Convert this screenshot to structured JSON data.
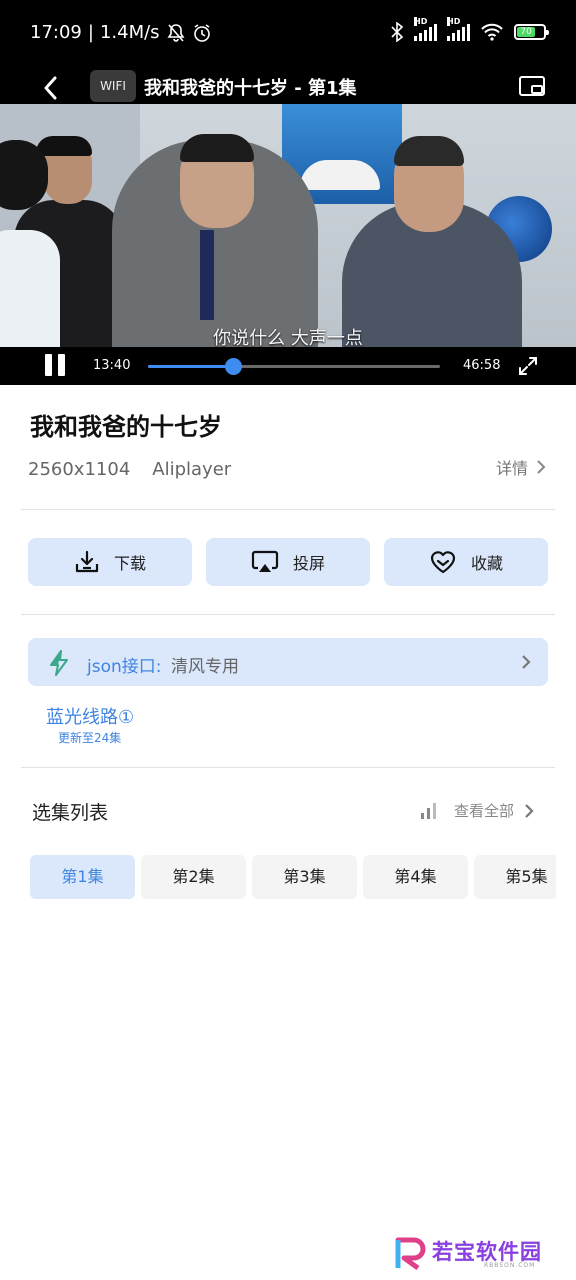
{
  "status_bar": {
    "time": "17:09",
    "speed": "1.4M/s",
    "battery": "70",
    "hd1": "HD",
    "hd2": "HD"
  },
  "player": {
    "wifi_chip": "WIFI",
    "title": "我和我爸的十七岁 - 第1集",
    "subtitle": "你说什么 大声一点",
    "current_time": "13:40",
    "total_time": "46:58",
    "progress_fraction": 0.291
  },
  "info": {
    "title": "我和我爸的十七岁",
    "resolution": "2560x1104",
    "player_name": "Aliplayer",
    "details_label": "详情"
  },
  "actions": [
    {
      "label": "下载",
      "icon": "download-icon"
    },
    {
      "label": "投屏",
      "icon": "cast-icon"
    },
    {
      "label": "收藏",
      "icon": "heart-icon"
    }
  ],
  "source": {
    "label": "json接口:",
    "value": "清风专用"
  },
  "line": {
    "name": "蓝光线路①",
    "update": "更新至24集"
  },
  "episodes": {
    "header": "选集列表",
    "view_all": "查看全部",
    "items": [
      "第1集",
      "第2集",
      "第3集",
      "第4集",
      "第5集"
    ],
    "active_index": 0
  },
  "watermark": {
    "text": "若宝软件园",
    "sub": "RBBSON.COM"
  },
  "colors": {
    "accent": "#3f84e0",
    "button_bg": "#dbe7fb"
  }
}
